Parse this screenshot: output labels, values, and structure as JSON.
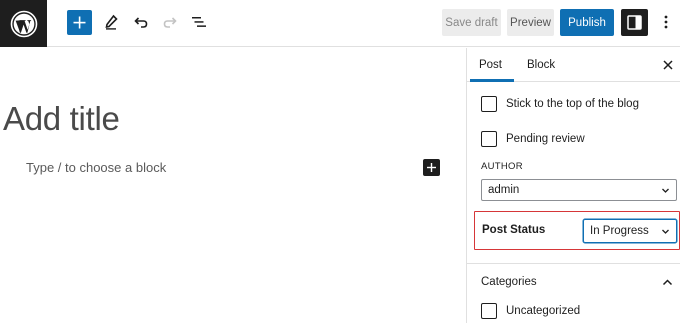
{
  "toolbar": {
    "logo_icon": "wordpress-logo",
    "add_block_icon": "plus-icon",
    "tools_icon": "pencil-icon",
    "undo_icon": "undo-icon",
    "redo_icon": "redo-icon",
    "outline_icon": "list-view-icon",
    "save_draft_label": "Save draft",
    "preview_label": "Preview",
    "publish_label": "Publish",
    "settings_icon": "sidebar-toggle-icon",
    "more_icon": "vertical-ellipsis-icon"
  },
  "editor": {
    "title_placeholder": "Add title",
    "block_hint": "Type / to choose a block"
  },
  "sidebar": {
    "tabs": [
      {
        "label": "Post",
        "active": true
      },
      {
        "label": "Block",
        "active": false
      }
    ],
    "close_icon": "close-icon",
    "stick_to_top_label": "Stick to the top of the blog",
    "pending_review_label": "Pending review",
    "author_label": "AUTHOR",
    "author_value": "admin",
    "post_status_label": "Post Status",
    "post_status_value": "In Progress",
    "categories_label": "Categories",
    "uncategorized_label": "Uncategorized"
  },
  "colors": {
    "accent": "#0f6fb3",
    "highlight_border": "#d63638",
    "dark": "#1e1e1e"
  }
}
